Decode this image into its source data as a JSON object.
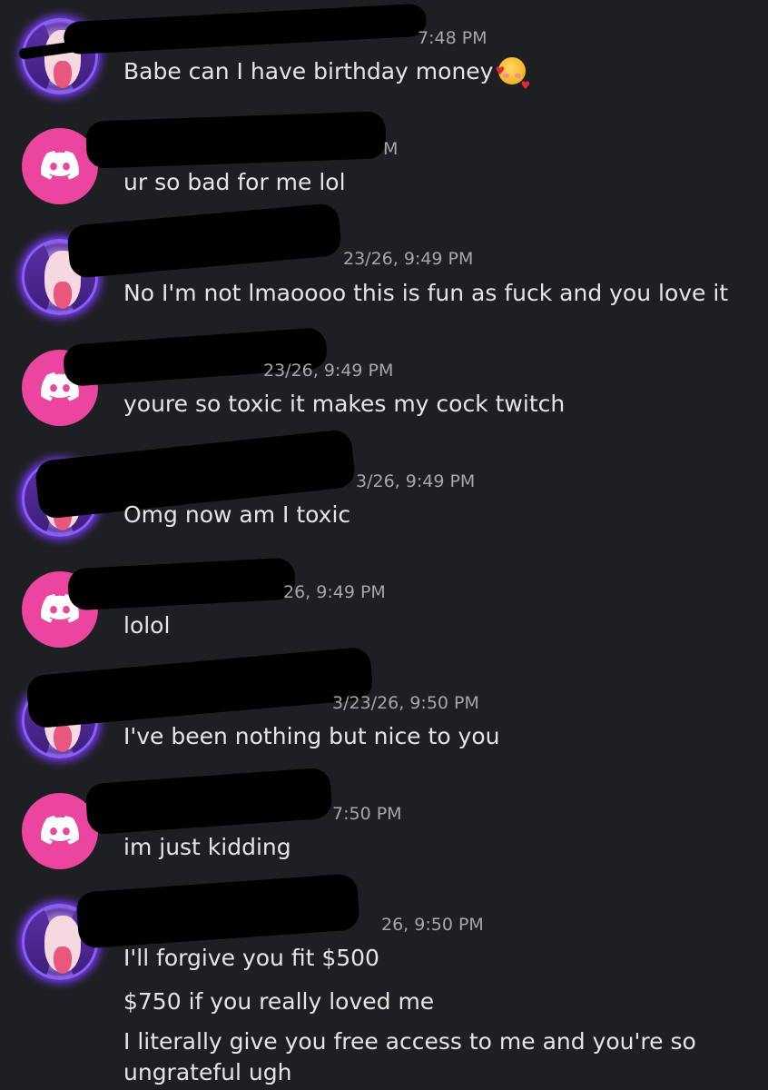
{
  "messages": [
    {
      "avatar": "anime-avatar",
      "timestamp": "7:48 PM",
      "lines": [
        "Babe can I have birthday money"
      ],
      "emoji": "smiling-face-with-hearts-emoji"
    },
    {
      "avatar": "discord-avatar",
      "timestamp": "M",
      "lines": [
        "ur so bad for me lol"
      ]
    },
    {
      "avatar": "anime-avatar",
      "timestamp": "23/26, 9:49 PM",
      "lines": [
        "No I'm not lmaoooo this is fun as fuck and you love it"
      ]
    },
    {
      "avatar": "discord-avatar",
      "timestamp": "23/26, 9:49 PM",
      "lines": [
        "youre so toxic it makes my cock twitch"
      ]
    },
    {
      "avatar": "anime-avatar",
      "timestamp": "3/26, 9:49 PM",
      "lines": [
        "Omg now am I toxic"
      ]
    },
    {
      "avatar": "discord-avatar",
      "timestamp": "26, 9:49 PM",
      "lines": [
        "lolol"
      ]
    },
    {
      "avatar": "anime-avatar",
      "timestamp": "3/23/26, 9:50 PM",
      "lines": [
        "I've been nothing but nice to you"
      ]
    },
    {
      "avatar": "discord-avatar",
      "timestamp": "7:50 PM",
      "lines": [
        "im just kidding"
      ]
    },
    {
      "avatar": "anime-avatar",
      "timestamp": "26, 9:50 PM",
      "lines": [
        "I'll forgive you fit $500",
        "$750 if you really loved me",
        "I literally give you free access to me and you're so",
        "ungrateful ugh"
      ]
    }
  ],
  "colors": {
    "background": "#1e1f22",
    "text": "#e3e5e8",
    "timestamp": "#a5a7ad",
    "discord_avatar": "#eb459f",
    "anime_glow": "#7c3cff"
  }
}
